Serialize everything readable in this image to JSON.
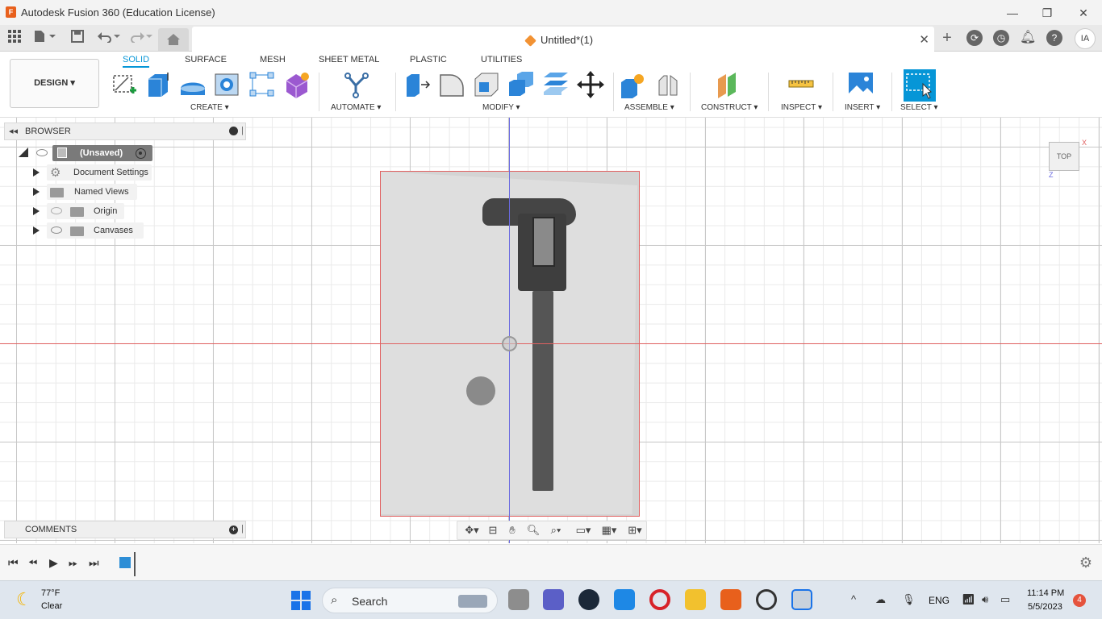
{
  "window": {
    "title": "Autodesk Fusion 360 (Education License)",
    "app_icon_letter": "F",
    "controls": {
      "minimize": "—",
      "maximize": "❐",
      "close": "✕"
    }
  },
  "quick_access": {
    "document_tab": "Untitled*(1)",
    "user_initials": "IA"
  },
  "toolbar": {
    "workspace": "DESIGN",
    "tabs": [
      "SOLID",
      "SURFACE",
      "MESH",
      "SHEET METAL",
      "PLASTIC",
      "UTILITIES"
    ],
    "active_tab": "SOLID",
    "groups": {
      "create": "CREATE",
      "automate": "AUTOMATE",
      "modify": "MODIFY",
      "assemble": "ASSEMBLE",
      "construct": "CONSTRUCT",
      "inspect": "INSPECT",
      "insert": "INSERT",
      "select": "SELECT"
    }
  },
  "browser": {
    "title": "BROWSER",
    "root": "(Unsaved)",
    "items": [
      {
        "label": "Document Settings"
      },
      {
        "label": "Named Views"
      },
      {
        "label": "Origin"
      },
      {
        "label": "Canvases"
      }
    ]
  },
  "comments": {
    "title": "COMMENTS"
  },
  "viewcube": {
    "face": "TOP",
    "x_axis": "X",
    "z_axis": "Z"
  },
  "taskbar": {
    "weather_temp": "77°F",
    "weather_cond": "Clear",
    "search": "Search",
    "lang": "ENG",
    "time": "11:14 PM",
    "date": "5/5/2023",
    "notifications": "4"
  },
  "colors": {
    "accent": "#0696d7",
    "x_axis": "#e06060",
    "y_axis": "#6a6ae0"
  }
}
